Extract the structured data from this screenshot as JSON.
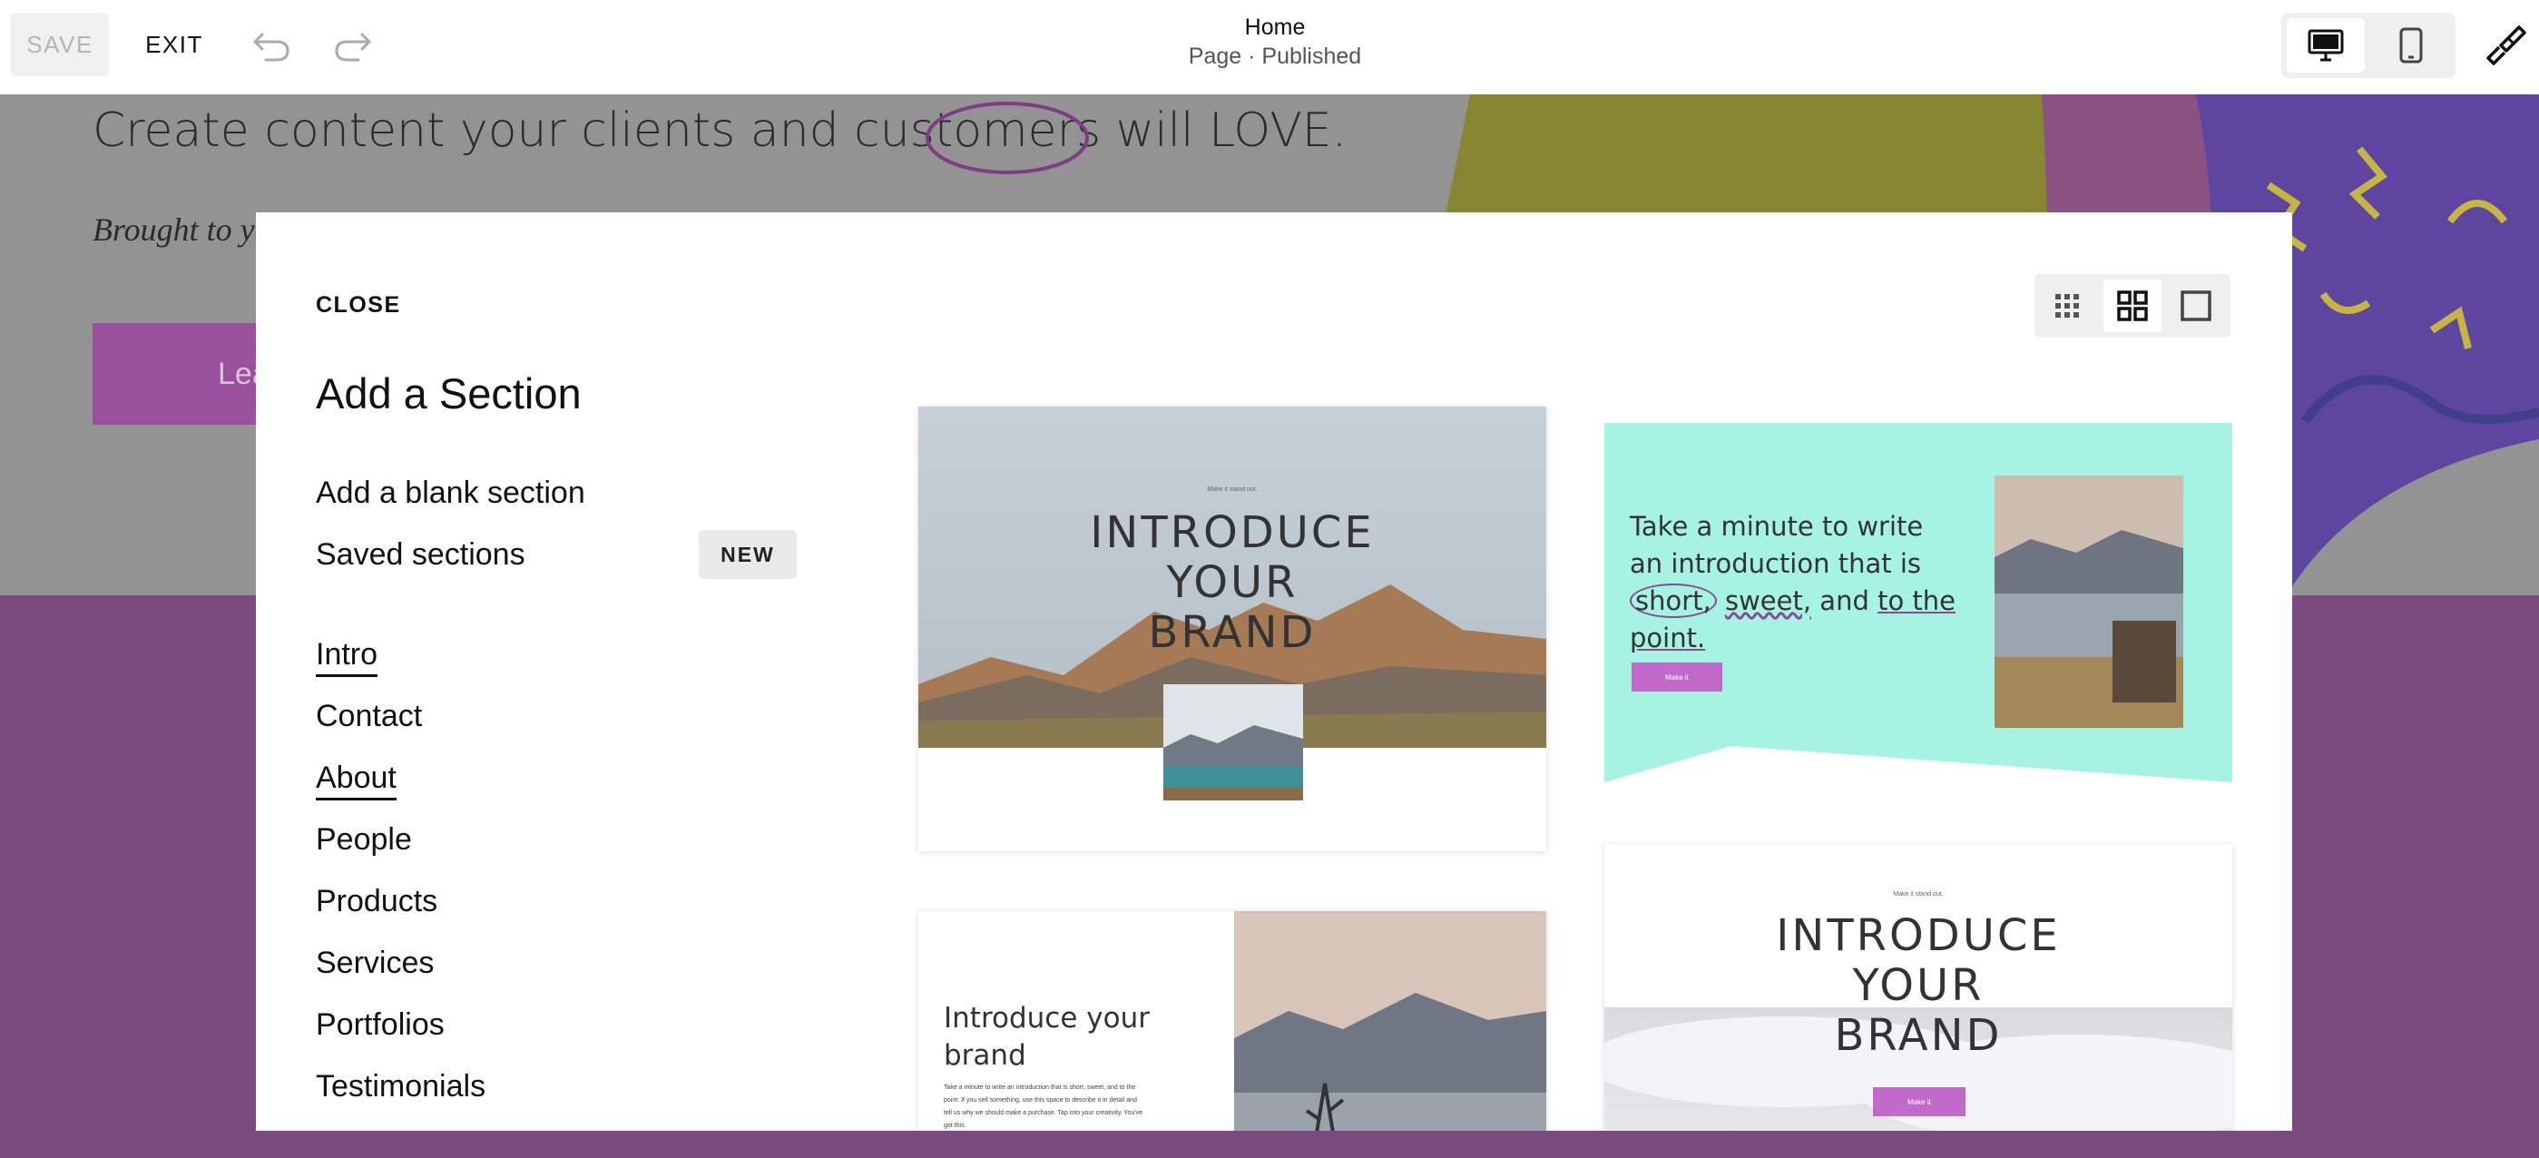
{
  "topbar": {
    "save_label": "SAVE",
    "exit_label": "EXIT",
    "page_title": "Home",
    "page_status": "Page · Published"
  },
  "background": {
    "headline": "Create content your clients and customers will LOVE.",
    "subline": "Brought to you",
    "button_label": "Lea"
  },
  "modal": {
    "close_label": "CLOSE",
    "title": "Add a Section",
    "blank_section_label": "Add a blank section",
    "saved_sections_label": "Saved sections",
    "new_badge": "NEW",
    "categories": [
      {
        "label": "Intro",
        "active": true
      },
      {
        "label": "Contact",
        "active": false
      },
      {
        "label": "About",
        "active": true
      },
      {
        "label": "People",
        "active": false
      },
      {
        "label": "Products",
        "active": false
      },
      {
        "label": "Services",
        "active": false
      },
      {
        "label": "Portfolios",
        "active": false
      },
      {
        "label": "Testimonials",
        "active": false
      }
    ]
  },
  "templates": {
    "card1": {
      "kicker": "Make it stand out.",
      "title_lines": [
        "INTRODUCE",
        "YOUR",
        "BRAND"
      ]
    },
    "card2": {
      "line1": "Take a minute to write",
      "line2": "an introduction that is",
      "line3a": "short,",
      "line3b": "sweet,",
      "line3c": "and",
      "line3d": "to the",
      "line4": "point.",
      "button": "Make it"
    },
    "card3": {
      "title_line1": "Introduce your",
      "title_line2": "brand",
      "body": "Take a minute to write an introduction that is short, sweet, and to the point. If you sell something, use this space to describe it in detail and tell us why we should make a purchase. Tap into your creativity. You've got this."
    },
    "card4": {
      "kicker": "Make it stand out.",
      "title_lines": [
        "INTRODUCE",
        "YOUR",
        "BRAND"
      ],
      "button": "Make it"
    }
  },
  "colors": {
    "accent_purple": "#9a519c",
    "mint": "#a6f3e3",
    "background_purple": "#7b4a7e"
  }
}
